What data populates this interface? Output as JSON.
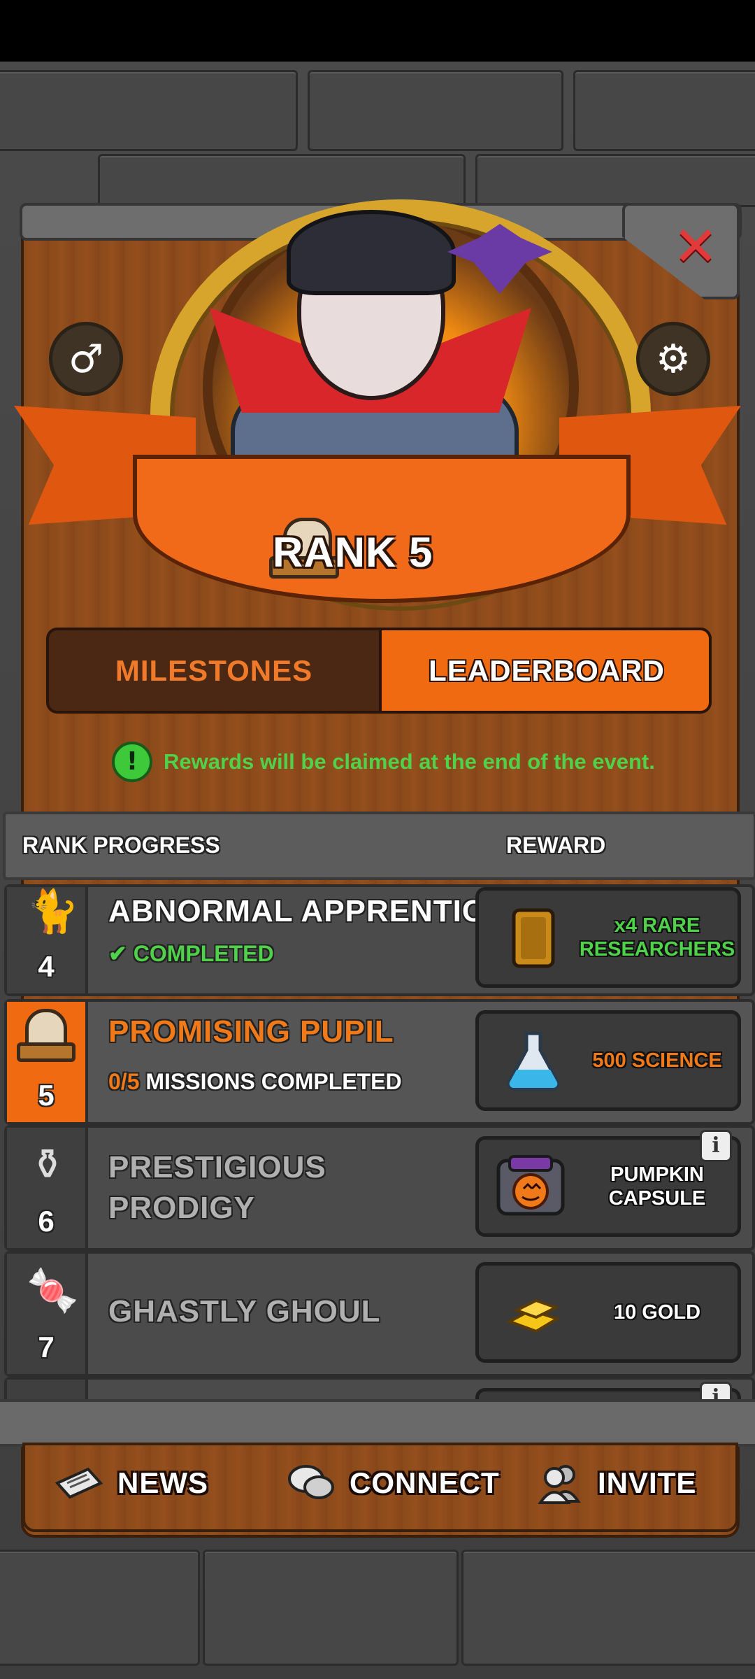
{
  "header": {
    "rank_title": "RANK 5",
    "close_icon": "close-icon",
    "gender_icon": "male-symbol-icon",
    "settings_icon": "gear-icon"
  },
  "tabs": [
    {
      "label": "MILESTONES",
      "active": false
    },
    {
      "label": "LEADERBOARD",
      "active": true
    }
  ],
  "notice": {
    "icon": "exclamation-icon",
    "text": "Rewards will be claimed at the end of the event."
  },
  "list": {
    "header_rank_progress": "RANK PROGRESS",
    "header_reward": "REWARD",
    "rows": [
      {
        "rank": "4",
        "icon": "cat-icon",
        "title": "ABNORMAL APPRENTICE",
        "status_icon": "checkmark-icon",
        "status": "COMPLETED",
        "reward_icon": "card-icon",
        "reward": "x4 RARE RESEARCHERS"
      },
      {
        "rank": "5",
        "icon": "tombstone-icon",
        "title": "PROMISING PUPIL",
        "progress": "0/5",
        "status": "MISSIONS COMPLETED",
        "reward_icon": "flask-icon",
        "reward": "500 SCIENCE"
      },
      {
        "rank": "6",
        "icon": "cauldron-icon",
        "title": "PRESTIGIOUS PRODIGY",
        "reward_icon": "pumpkin-capsule-icon",
        "reward": "PUMPKIN CAPSULE",
        "info": "i"
      },
      {
        "rank": "7",
        "icon": "candy-icon",
        "title": "GHASTLY GHOUL",
        "reward_icon": "gold-bars-icon",
        "reward": "10 GOLD"
      }
    ]
  },
  "bottom_nav": [
    {
      "label": "NEWS",
      "icon": "newspaper-icon"
    },
    {
      "label": "CONNECT",
      "icon": "chat-bubbles-icon"
    },
    {
      "label": "INVITE",
      "icon": "people-icon"
    }
  ],
  "colors": {
    "accent_orange": "#f06a12",
    "success_green": "#4fd14a",
    "close_red": "#e23a3a",
    "panel_brown": "#8a4a1a"
  }
}
